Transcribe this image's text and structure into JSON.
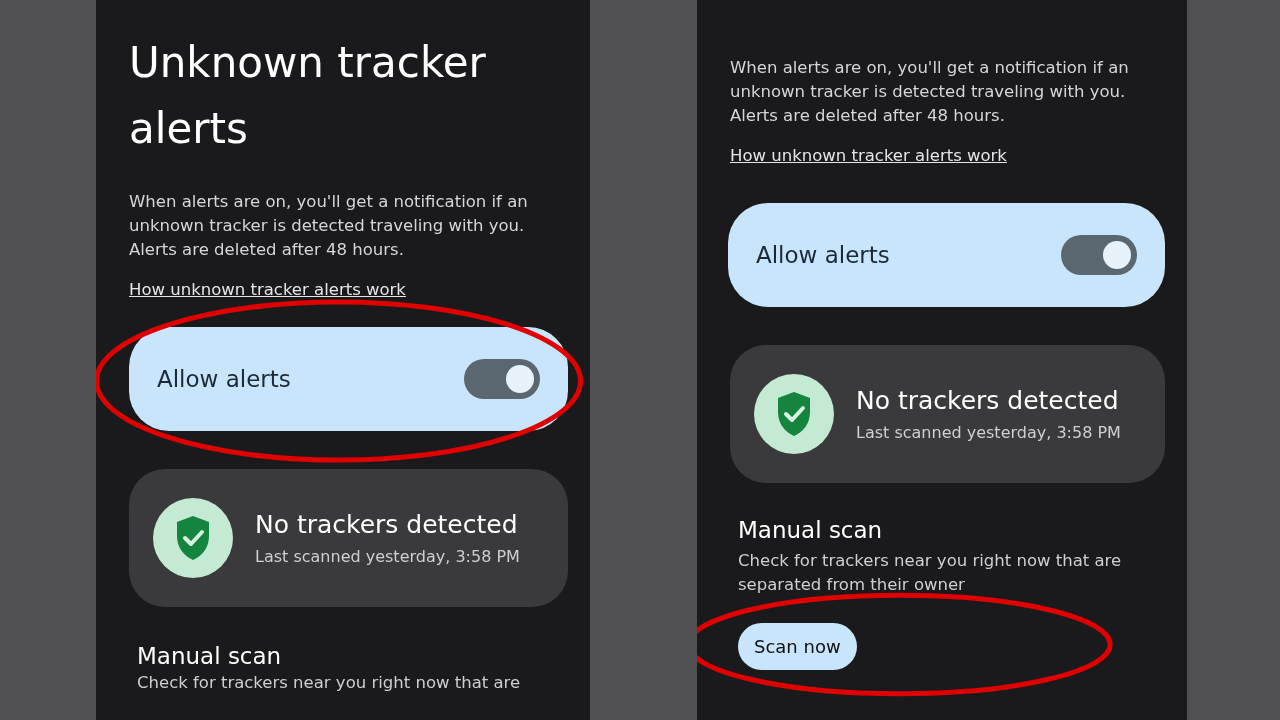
{
  "panels": [
    {
      "title": "Unknown tracker alerts",
      "description": "When alerts are on, you'll get a notification if an unknown tracker is detected traveling with you. Alerts are deleted after 48 hours.",
      "link": "How unknown tracker alerts work",
      "toggle": {
        "label": "Allow alerts",
        "on": true,
        "annotated": true
      },
      "status": {
        "title": "No trackers detected",
        "subtitle": "Last scanned yesterday, 3:58 PM"
      },
      "manual_scan": {
        "title": "Manual scan",
        "description": "Check for trackers near you right now that are"
      }
    },
    {
      "description": "When alerts are on, you'll get a notification if an unknown tracker is detected traveling with you. Alerts are deleted after 48 hours.",
      "link": "How unknown tracker alerts work",
      "toggle": {
        "label": "Allow alerts",
        "on": true,
        "annotated": false
      },
      "status": {
        "title": "No trackers detected",
        "subtitle": "Last scanned yesterday, 3:58 PM"
      },
      "manual_scan": {
        "title": "Manual scan",
        "description": "Check for trackers near you right now that are separated from their owner",
        "button": {
          "label": "Scan now",
          "annotated": true
        }
      }
    }
  ]
}
